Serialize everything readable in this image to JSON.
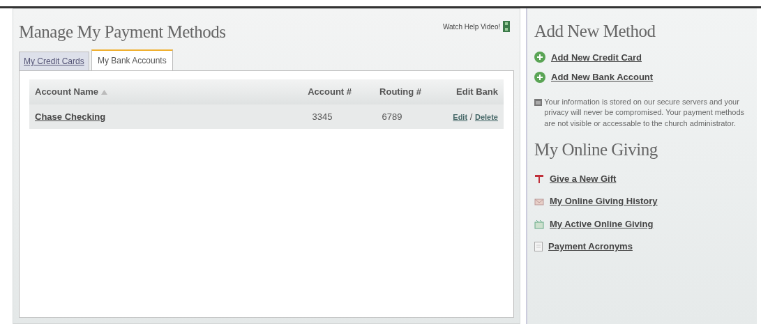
{
  "main": {
    "title": "Manage My Payment Methods",
    "help_link": "Watch Help Video!",
    "tabs": [
      {
        "label": "My Credit Cards",
        "selected": false
      },
      {
        "label": "My Bank Accounts",
        "selected": true
      }
    ],
    "table": {
      "columns": [
        "Account Name",
        "Account #",
        "Routing #",
        "Edit Bank"
      ],
      "rows": [
        {
          "name": "Chase Checking",
          "account": "3345",
          "routing": "6789",
          "edit": "Edit",
          "separator": "/",
          "delete": "Delete"
        }
      ]
    }
  },
  "sidebar": {
    "add_title": "Add New Method",
    "add_links": [
      "Add New Credit Card",
      "Add New Bank Account"
    ],
    "notice": "Your information is stored on our secure servers and your privacy will never be compromised. Your payment methods are not visible or accessable to the church administrator.",
    "giving_title": "My Online Giving",
    "giving_links": [
      {
        "kind": "gift",
        "label": "Give a New Gift"
      },
      {
        "kind": "history",
        "label": "My Online Giving History"
      },
      {
        "kind": "active",
        "label": "My Active Online Giving"
      },
      {
        "kind": "document",
        "label": "Payment Acronyms"
      }
    ]
  }
}
